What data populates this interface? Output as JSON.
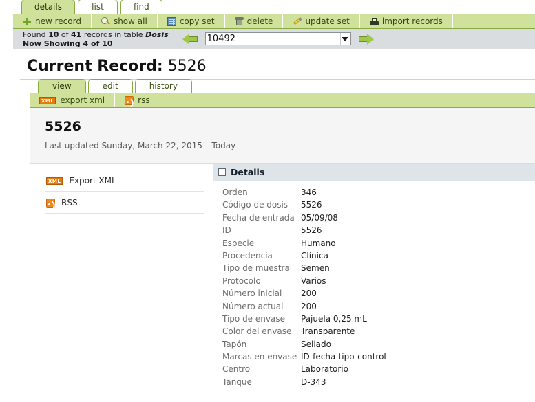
{
  "top_tabs": [
    {
      "label": "details",
      "active": true
    },
    {
      "label": "list",
      "active": false
    },
    {
      "label": "find",
      "active": false
    }
  ],
  "toolbar": {
    "items": [
      {
        "label": "new record",
        "icon": "plus-icon"
      },
      {
        "label": "show all",
        "icon": "magnifier-icon"
      },
      {
        "label": "copy set",
        "icon": "grid-icon"
      },
      {
        "label": "delete",
        "icon": "trash-icon"
      },
      {
        "label": "update set",
        "icon": "pencil-icon"
      },
      {
        "label": "import records",
        "icon": "inbox-icon"
      }
    ]
  },
  "findbar": {
    "found_prefix": "Found ",
    "found_count": "10",
    "found_mid": " of ",
    "found_total": "41",
    "found_suffix": " records in table ",
    "table_name": "Dosis",
    "now_showing": "Now Showing 4 of 10",
    "prev_arrow": "arrow-left-icon",
    "next_arrow": "arrow-right-icon",
    "record_select_value": "10492",
    "record_select_options": [
      "10492"
    ]
  },
  "header": {
    "title_label": "Current Record:",
    "title_value": "5526"
  },
  "sub_tabs": [
    {
      "label": "view",
      "active": true
    },
    {
      "label": "edit",
      "active": false
    },
    {
      "label": "history",
      "active": false
    }
  ],
  "sub_toolbar": {
    "items": [
      {
        "label": "export xml",
        "icon": "xml-badge-icon"
      },
      {
        "label": "rss",
        "icon": "rss-badge-icon"
      }
    ]
  },
  "record_panel": {
    "record_id": "5526",
    "last_updated": "Last updated Sunday, March 22, 2015 – Today"
  },
  "sidebar": {
    "links": [
      {
        "label": "Export XML",
        "icon": "xml-badge-icon"
      },
      {
        "label": "RSS",
        "icon": "rss-badge-icon"
      }
    ]
  },
  "details": {
    "panel_title": "Details",
    "collapse_icon": "collapse-minus-icon",
    "fields": [
      {
        "label": "Orden",
        "value": "346"
      },
      {
        "label": "Código de dosis",
        "value": "5526"
      },
      {
        "label": "Fecha de entrada",
        "value": "05/09/08"
      },
      {
        "label": "ID",
        "value": "5526"
      },
      {
        "label": "Especie",
        "value": "Humano"
      },
      {
        "label": "Procedencia",
        "value": "Clínica"
      },
      {
        "label": "Tipo de muestra",
        "value": "Semen"
      },
      {
        "label": "Protocolo",
        "value": "Varios"
      },
      {
        "label": "Número inicial",
        "value": "200"
      },
      {
        "label": "Número actual",
        "value": "200"
      },
      {
        "label": "Tipo de envase",
        "value": "Pajuela 0,25 mL"
      },
      {
        "label": "Color del envase",
        "value": "Transparente"
      },
      {
        "label": "Tapón",
        "value": "Sellado"
      },
      {
        "label": "Marcas en envase",
        "value": "ID-fecha-tipo-control"
      },
      {
        "label": "Centro",
        "value": "Laboratorio"
      },
      {
        "label": "Tanque",
        "value": "D-343"
      }
    ]
  },
  "colors": {
    "toolbar_green": "#cfe19a",
    "toolbar_border": "#8aab3d",
    "findbar_gray": "#d9dde0",
    "details_header": "#dfe4e8",
    "accent_orange": "#e8790c",
    "arrow_green": "#9fc84a"
  }
}
